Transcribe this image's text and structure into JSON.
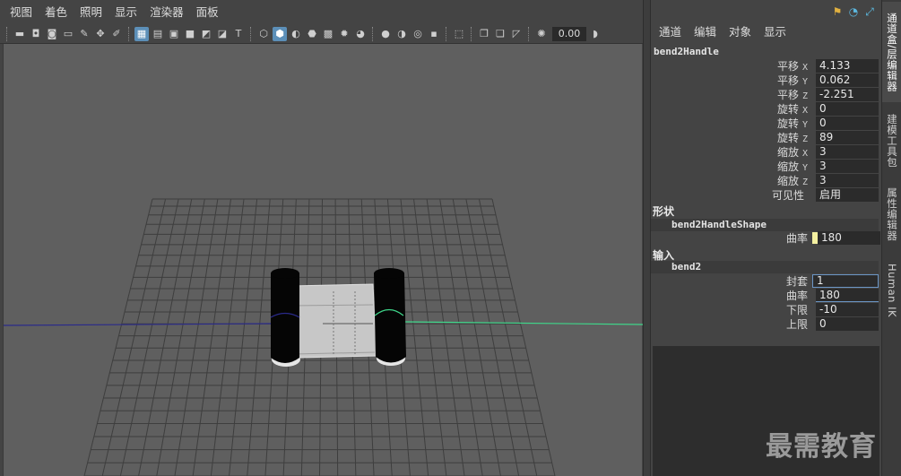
{
  "viewport": {
    "menu": [
      "视图",
      "着色",
      "照明",
      "显示",
      "渲染器",
      "面板"
    ],
    "zoom_value": "0.00"
  },
  "channel_box": {
    "menu": [
      "通道",
      "编辑",
      "对象",
      "显示"
    ],
    "object_name": "bend2Handle",
    "attributes": [
      {
        "label": "平移",
        "axis": "X",
        "value": "4.133"
      },
      {
        "label": "平移",
        "axis": "Y",
        "value": "0.062"
      },
      {
        "label": "平移",
        "axis": "Z",
        "value": "-2.251"
      },
      {
        "label": "旋转",
        "axis": "X",
        "value": "0"
      },
      {
        "label": "旋转",
        "axis": "Y",
        "value": "0"
      },
      {
        "label": "旋转",
        "axis": "Z",
        "value": "89"
      },
      {
        "label": "缩放",
        "axis": "X",
        "value": "3"
      },
      {
        "label": "缩放",
        "axis": "Y",
        "value": "3"
      },
      {
        "label": "缩放",
        "axis": "Z",
        "value": "3"
      },
      {
        "label": "可见性",
        "axis": "",
        "value": "启用"
      }
    ],
    "shape_section": {
      "title": "形状",
      "node": "bend2HandleShape",
      "attributes": [
        {
          "label": "曲率",
          "value": "180"
        }
      ]
    },
    "input_section": {
      "title": "输入",
      "node": "bend2",
      "attributes": [
        {
          "label": "封套",
          "value": "1"
        },
        {
          "label": "曲率",
          "value": "180"
        },
        {
          "label": "下限",
          "value": "-10"
        },
        {
          "label": "上限",
          "value": "0"
        }
      ]
    },
    "watermark": "最需教育"
  },
  "side_tabs": [
    "通道盒/层编辑器",
    "建模工具包",
    "属性编辑器",
    "Human IK"
  ],
  "colors": {
    "panel_bg": "#444444",
    "viewport_bg": "#5f5f5f",
    "field_bg": "#2b2b2b",
    "focus_border": "#6b96c6",
    "keyed_marker": "#f4f0a0",
    "axis_x": "#2a2a8a",
    "axis_z": "#3fd68a"
  }
}
